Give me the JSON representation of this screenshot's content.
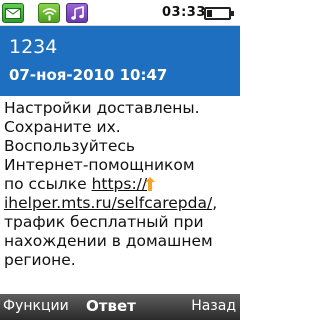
{
  "status_bar": {
    "time": "03:33",
    "icons": [
      "envelope-icon",
      "wifi-icon",
      "music-icon",
      "battery-icon"
    ],
    "battery_level": 0.25
  },
  "message": {
    "sender": "1234",
    "date": "07-ноя-2010 10:47",
    "lines": [
      "Настройки доставлены.",
      "Сохраните их.",
      "Воспользуйтесь",
      "Интернет-помощником",
      "по ссылке "
    ],
    "link_part1": "https://",
    "link_part2": "ihelper.mts.ru/selfcarepda/",
    "link_tail": ",",
    "lines_after": [
      "трафик бесплатный при",
      "нахождении в домашнем",
      "регионе."
    ]
  },
  "softkeys": {
    "left": "Функции",
    "center": "Ответ",
    "right": "Назад"
  },
  "colors": {
    "header_bg": "#1e6fbf",
    "softkey_bg": "#2a2a2a",
    "selection_marker": "#f5a623"
  }
}
